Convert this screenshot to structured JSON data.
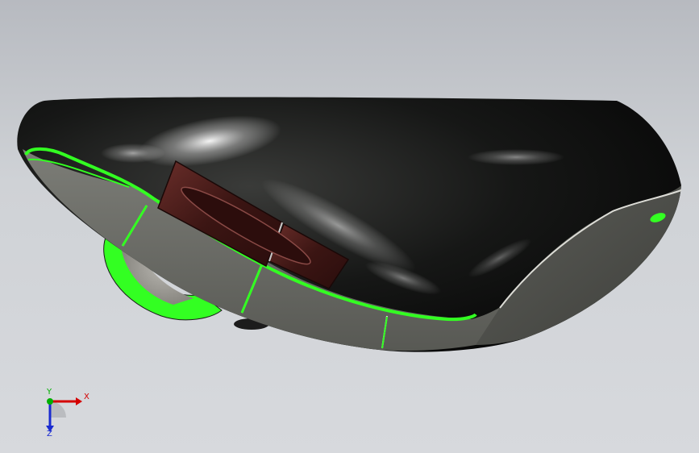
{
  "viewport": {
    "background_top": "#b7bac0",
    "background_bottom": "#d7d9dd"
  },
  "model": {
    "body_color": "#0e0f0e",
    "side_panel_color": "#6f706a",
    "edge_highlight_color": "#33ff22",
    "button_color": "#4a1e1c"
  },
  "triad": {
    "x_label": "X",
    "y_label": "Y",
    "z_label": "Z",
    "x_color": "#d40000",
    "y_color": "#00b000",
    "z_color": "#1a2bd0"
  }
}
